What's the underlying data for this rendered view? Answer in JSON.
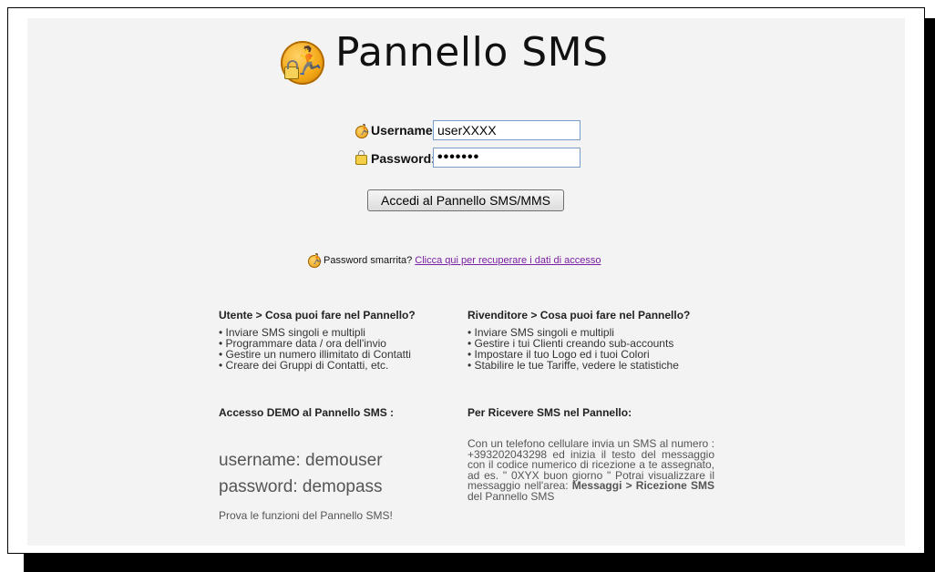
{
  "header": {
    "title": "Pannello SMS",
    "logo_icon": "runner-lock-logo-icon"
  },
  "form": {
    "username_label": "Username:",
    "username_value": "userXXXX",
    "password_label": "Password:",
    "password_value": "•••••••",
    "submit_label": "Accedi al Pannello SMS/MMS"
  },
  "recovery": {
    "text": "Password smarrita?",
    "link": "Clicca qui per recuperare i dati di accesso"
  },
  "utente": {
    "heading": "Utente > Cosa puoi fare nel Pannello?",
    "items": [
      "Inviare SMS singoli e multipli",
      "Programmare data / ora dell'invio",
      "Gestire un numero illimitato di Contatti",
      "Creare dei Gruppi di Contatti, etc."
    ]
  },
  "rivenditore": {
    "heading": "Rivenditore > Cosa puoi fare nel Pannello?",
    "items": [
      "Inviare SMS singoli e multipli",
      "Gestire i tui Clienti creando sub-accounts",
      "Impostare il tuo Logo ed i tuoi Colori",
      "Stabilire le tue Tariffe, vedere le statistiche"
    ]
  },
  "demo": {
    "heading": "Accesso DEMO al Pannello SMS :",
    "username_line": "username:  demouser",
    "password_line": "password:  demopass",
    "note": "Prova le funzioni del Pannello SMS!"
  },
  "ricevere": {
    "heading": "Per Ricevere SMS nel Pannello:",
    "text_1": "Con un telefono cellulare invia un SMS al numero : +393202043298 ed inizia il testo del messaggio con il codice numerico di ricezione a te assegnato, ad es. \" 0XYX buon giorno \" Potrai visualizzare il messaggio nell'area: ",
    "bold": "Messaggi > Ricezione SMS",
    "text_2": " del Pannello SMS"
  }
}
